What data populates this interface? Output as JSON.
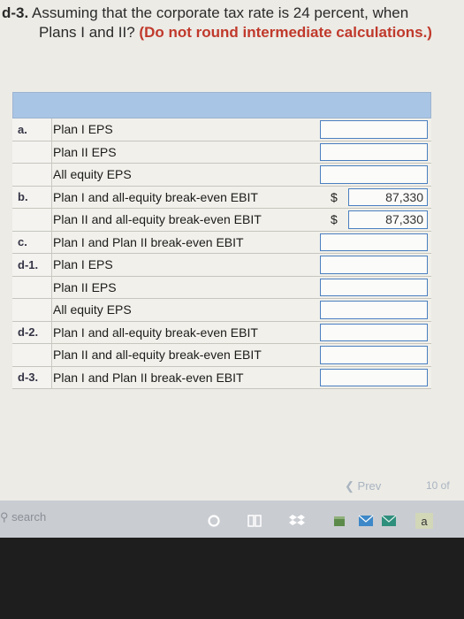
{
  "question": {
    "number": "d-3.",
    "line1": "Assuming that the corporate tax rate is 24 percent, when",
    "line2_prefix": "Plans I and II?",
    "note": "(Do not round intermediate calculations.)"
  },
  "rows": [
    {
      "label": "a.",
      "text": "Plan I EPS",
      "dollar": "",
      "value": ""
    },
    {
      "label": "",
      "text": "Plan II EPS",
      "dollar": "",
      "value": ""
    },
    {
      "label": "",
      "text": "All equity EPS",
      "dollar": "",
      "value": ""
    },
    {
      "label": "b.",
      "text": "Plan I and all-equity break-even EBIT",
      "dollar": "$",
      "value": "87,330"
    },
    {
      "label": "",
      "text": "Plan II and all-equity break-even EBIT",
      "dollar": "$",
      "value": "87,330"
    },
    {
      "label": "c.",
      "text": "Plan I and Plan II break-even EBIT",
      "dollar": "",
      "value": ""
    },
    {
      "label": "d-1.",
      "text": "Plan I EPS",
      "dollar": "",
      "value": ""
    },
    {
      "label": "",
      "text": "Plan II EPS",
      "dollar": "",
      "value": ""
    },
    {
      "label": "",
      "text": "All equity EPS",
      "dollar": "",
      "value": ""
    },
    {
      "label": "d-2.",
      "text": "Plan I and all-equity break-even EBIT",
      "dollar": "",
      "value": ""
    },
    {
      "label": "",
      "text": "Plan II and all-equity break-even EBIT",
      "dollar": "",
      "value": ""
    },
    {
      "label": "d-3.",
      "text": "Plan I and Plan II break-even EBIT",
      "dollar": "",
      "value": ""
    }
  ],
  "nav": {
    "prev_label": "Prev",
    "page": "10 of"
  },
  "taskbar": {
    "search_label": "search",
    "icons": [
      "cortana-icon",
      "task-view-icon",
      "dropbox-icon",
      "file-icon",
      "mail-icon",
      "store-icon",
      "app-a-icon"
    ],
    "app_a_label": "a"
  },
  "colors": {
    "header": "#a9c5e6",
    "cell_border": "#4a7fc0",
    "note": "#c0392b"
  }
}
